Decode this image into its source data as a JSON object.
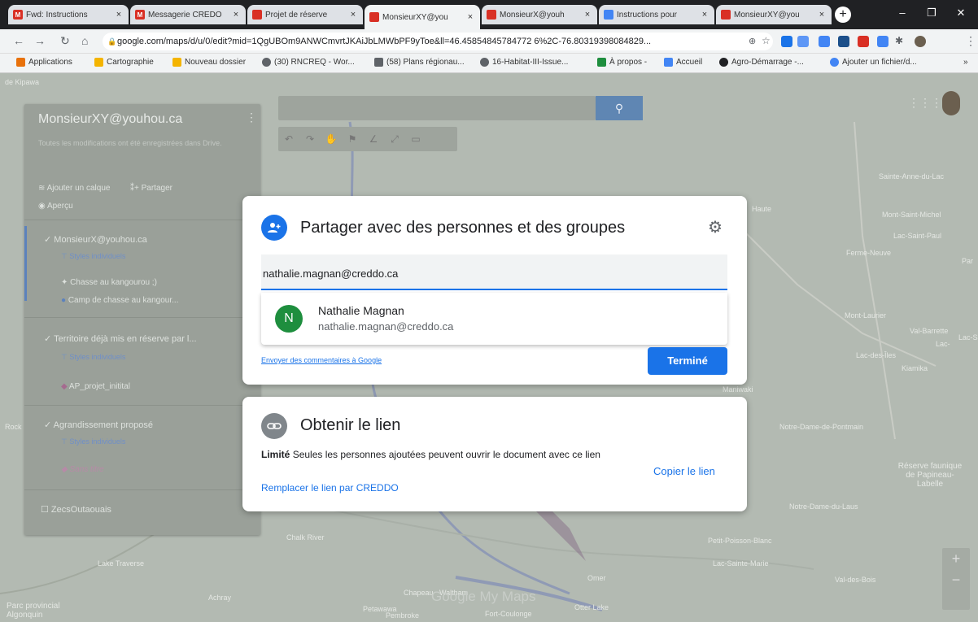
{
  "browser": {
    "tabs": [
      {
        "title": "Fwd: Instructions",
        "favicon": "gmail-icon",
        "color": "#d93025",
        "active": false
      },
      {
        "title": "Messagerie CREDO",
        "favicon": "gmail-icon",
        "color": "#d93025",
        "active": false
      },
      {
        "title": "Projet de réserve",
        "favicon": "maps-icon",
        "color": "#d93025",
        "active": false
      },
      {
        "title": "MonsieurXY@you",
        "favicon": "maps-icon",
        "color": "#d93025",
        "active": true
      },
      {
        "title": "MonsieurX@youh",
        "favicon": "maps-icon",
        "color": "#d93025",
        "active": false
      },
      {
        "title": "Instructions pour",
        "favicon": "docs-icon",
        "color": "#4285f4",
        "active": false
      },
      {
        "title": "MonsieurXY@you",
        "favicon": "maps-icon",
        "color": "#d93025",
        "active": false
      }
    ],
    "tab_close": "×",
    "new_tab": "+",
    "url": "google.com/maps/d/u/0/edit?mid=1QgUBOm9ANWCmvrtJKAiJbLMWbPF9yToe&ll=46.45854845784772 6%2C-76.80319398084829..."
  },
  "bookmarks": [
    {
      "label": "Applications",
      "color": "#e8710a"
    },
    {
      "label": "Cartographie",
      "color": "#f4b400"
    },
    {
      "label": "Nouveau dossier",
      "color": "#f4b400"
    },
    {
      "label": "(30) RNCREQ - Wor...",
      "color": "#5f6368"
    },
    {
      "label": "(58) Plans régionau...",
      "color": "#5f6368"
    },
    {
      "label": "16-Habitat-III-Issue...",
      "color": "#5f6368"
    },
    {
      "label": "À propos -",
      "color": "#1e8e3e"
    },
    {
      "label": "Accueil",
      "color": "#4285f4"
    },
    {
      "label": "Agro-Démarrage -...",
      "color": "#202124"
    },
    {
      "label": "Ajouter un fichier/d...",
      "color": "#4285f4"
    }
  ],
  "panel": {
    "title": "MonsieurXY@youhou.ca",
    "subtitle": "Toutes les modifications ont été enregistrées dans Drive.",
    "add_layer": "Ajouter un calque",
    "share": "Partager",
    "preview": "Aperçu",
    "layers": [
      {
        "name": "MonsieurX@youhou.ca",
        "style": "Styles individuels",
        "items": [
          "Chasse au kangourou ;)",
          "Camp de chasse au kangour..."
        ]
      },
      {
        "name": "Territoire déjà mis en réserve par l...",
        "style": "Styles individuels",
        "items": [
          "AP_projet_initital"
        ]
      },
      {
        "name": "Agrandissement proposé",
        "style": "Styles individuels",
        "items": [
          "Sans titre"
        ]
      },
      {
        "name": "ZecsOutaouais",
        "style": "",
        "items": []
      }
    ]
  },
  "map": {
    "labels": [
      "de Kipawa",
      "Sainte-Anne-du-Lac",
      "Mont-Saint-Michel",
      "Lac-Saint-Paul",
      "Ferme-Neuve",
      "Mont-Laurier",
      "Val-Barrette",
      "Lac-Sai",
      "Lac-des-Îles",
      "Kiamika",
      "Notre-Dame-de-Pontmain",
      "Réserve faunique de Papineau-Labelle",
      "Notre-Dame-du-Laus",
      "Chalk River",
      "Petit-Poisson-Blanc",
      "Lac-Sainte-Marie",
      "Val-des-Bois",
      "Petawawa",
      "Chapeau",
      "Waltham",
      "Otter Lake",
      "Pembroke",
      "Fort-Coulonge",
      "Parc provincial Algonquin",
      "Lake Traverse",
      "Achray",
      "Rock",
      "Haute",
      "Maniwaki",
      "Omer",
      "Lac-",
      "Par"
    ],
    "watermark": "Google My Maps"
  },
  "share_dialog": {
    "title": "Partager avec des personnes et des groupes",
    "input_value": "nathalie.magnan@creddo.ca",
    "suggestion_initial": "N",
    "suggestion_name": "Nathalie Magnan",
    "suggestion_email": "nathalie.magnan@creddo.ca",
    "feedback": "Envoyer des commentaires à Google",
    "done": "Terminé"
  },
  "link_dialog": {
    "title": "Obtenir le lien",
    "access_level": "Limité",
    "description": "Seules les personnes ajoutées peuvent ouvrir le document avec ce lien",
    "copy": "Copier le lien",
    "replace": "Remplacer le lien par CREDDO"
  },
  "colors": {
    "accent": "#1a73e8",
    "share_icon": "#1a73e8",
    "link_icon": "#80868b"
  }
}
